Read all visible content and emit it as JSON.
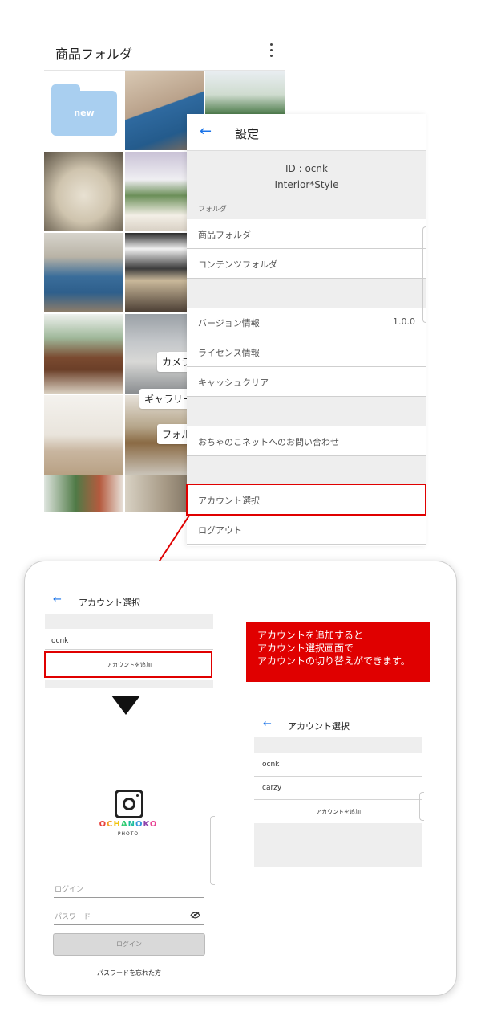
{
  "colors": {
    "accent": "#1a73e8",
    "highlight": "#e00000",
    "folder": "#a9cff0",
    "gray_bg": "#eeeeee"
  },
  "folder_screen": {
    "title": "商品フォルダ",
    "more_icon": "more-vert-icon",
    "folder_tile_label": "new",
    "overlay_buttons": [
      "カメラ",
      "ギャラリー",
      "フォル"
    ]
  },
  "settings": {
    "back_icon": "arrow-left-icon",
    "title": "設定",
    "id_line": "ID : ocnk",
    "store_name": "Interior*Style",
    "section_label": "フォルダ",
    "rows": {
      "product_folder": "商品フォルダ",
      "content_folder": "コンテンツフォルダ",
      "version_label": "バージョン情報",
      "version_value": "1.0.0",
      "license": "ライセンス情報",
      "cache_clear": "キャッシュクリア",
      "contact": "おちゃのこネットへのお問い合わせ",
      "account_select": "アカウント選択",
      "logout": "ログアウト"
    }
  },
  "card": {
    "screen1": {
      "title": "アカウント選択",
      "accounts": [
        "ocnk"
      ],
      "add_account": "アカウントを追加"
    },
    "callout_lines": [
      "アカウントを追加すると",
      "アカウント選択画面で",
      "アカウントの切り替えができます。"
    ],
    "login_screen": {
      "logo_text": "OCHANOKO",
      "logo_letters": [
        "O",
        "C",
        "H",
        "A",
        "N",
        "O",
        "K",
        "O"
      ],
      "logo_colors": [
        "#e8423d",
        "#f39c1f",
        "#f1c40f",
        "#2ecc71",
        "#1abc9c",
        "#3498db",
        "#8e44ad",
        "#e84393"
      ],
      "logo_sub": "PHOTO",
      "login_placeholder": "ログイン",
      "password_placeholder": "パスワード",
      "login_button": "ログイン",
      "forgot_password": "パスワードを忘れた方"
    },
    "screen2": {
      "title": "アカウント選択",
      "accounts": [
        "ocnk",
        "carzy"
      ],
      "add_account": "アカウントを追加"
    }
  }
}
